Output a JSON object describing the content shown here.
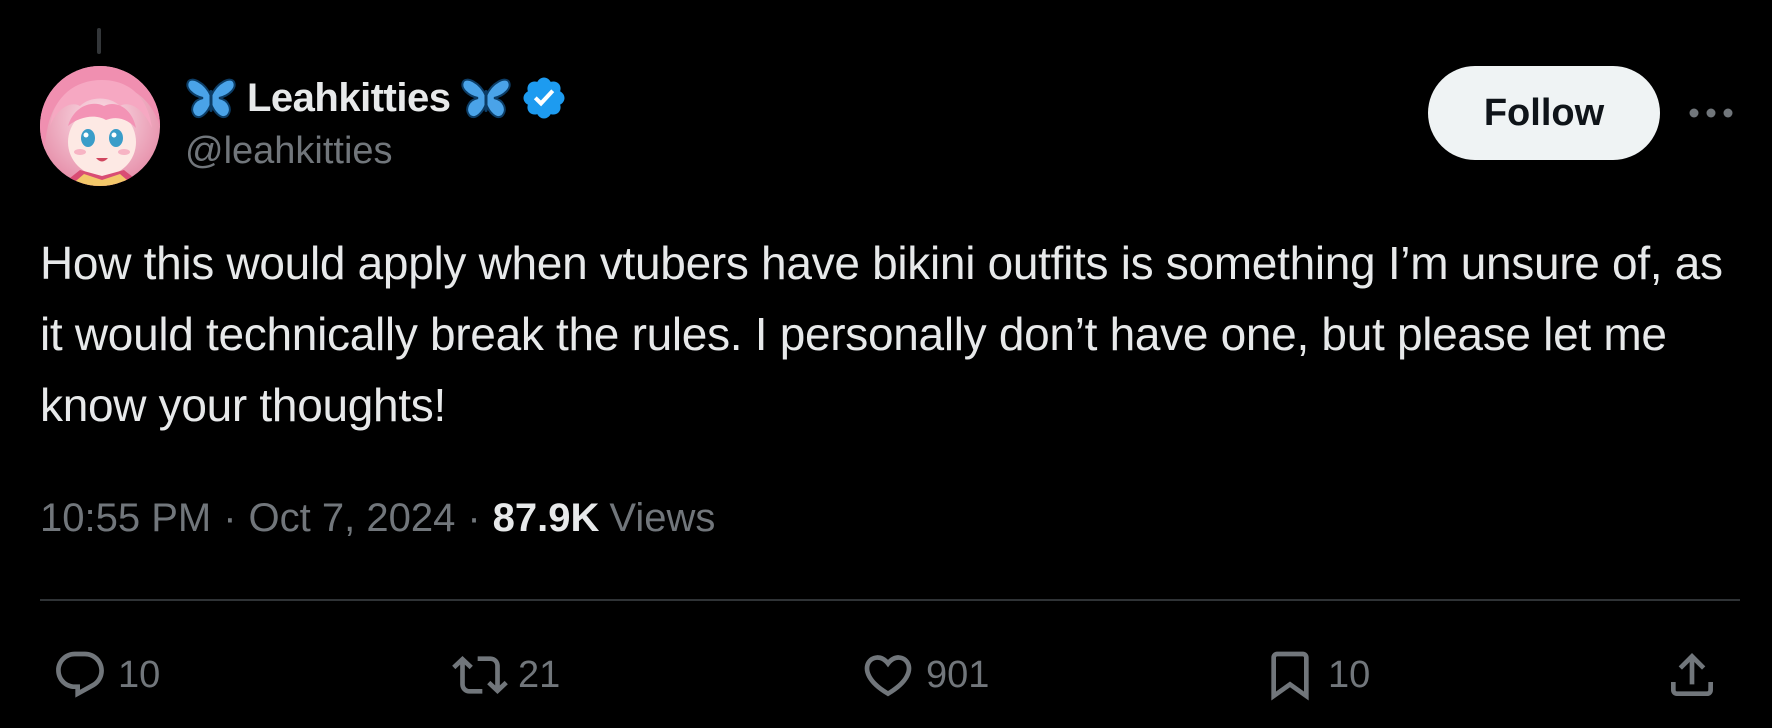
{
  "author": {
    "display_name": "Leahkitties",
    "handle": "@leahkitties",
    "verified": true,
    "name_emoji": "butterfly-icon"
  },
  "follow_button": {
    "label": "Follow"
  },
  "more_menu": {
    "icon": "more-horizontal-icon"
  },
  "tweet": {
    "text": "How this would apply when vtubers have bikini outfits is something I’m unsure of, as it would technically break the rules. I personally don’t have one, but please let me know your thoughts!",
    "time": "10:55 PM",
    "separator": "·",
    "date": "Oct 7, 2024",
    "views_count": "87.9K",
    "views_label": "Views"
  },
  "actions": {
    "replies": "10",
    "reposts": "21",
    "likes": "901",
    "bookmarks": "10"
  },
  "colors": {
    "background": "#000000",
    "primary_text": "#e7e9ea",
    "secondary_text": "#71767b",
    "verified_blue": "#1d9bf0",
    "butterfly_blue": "#4aa3e8",
    "follow_bg": "#eff3f4",
    "divider": "#2f3336"
  }
}
